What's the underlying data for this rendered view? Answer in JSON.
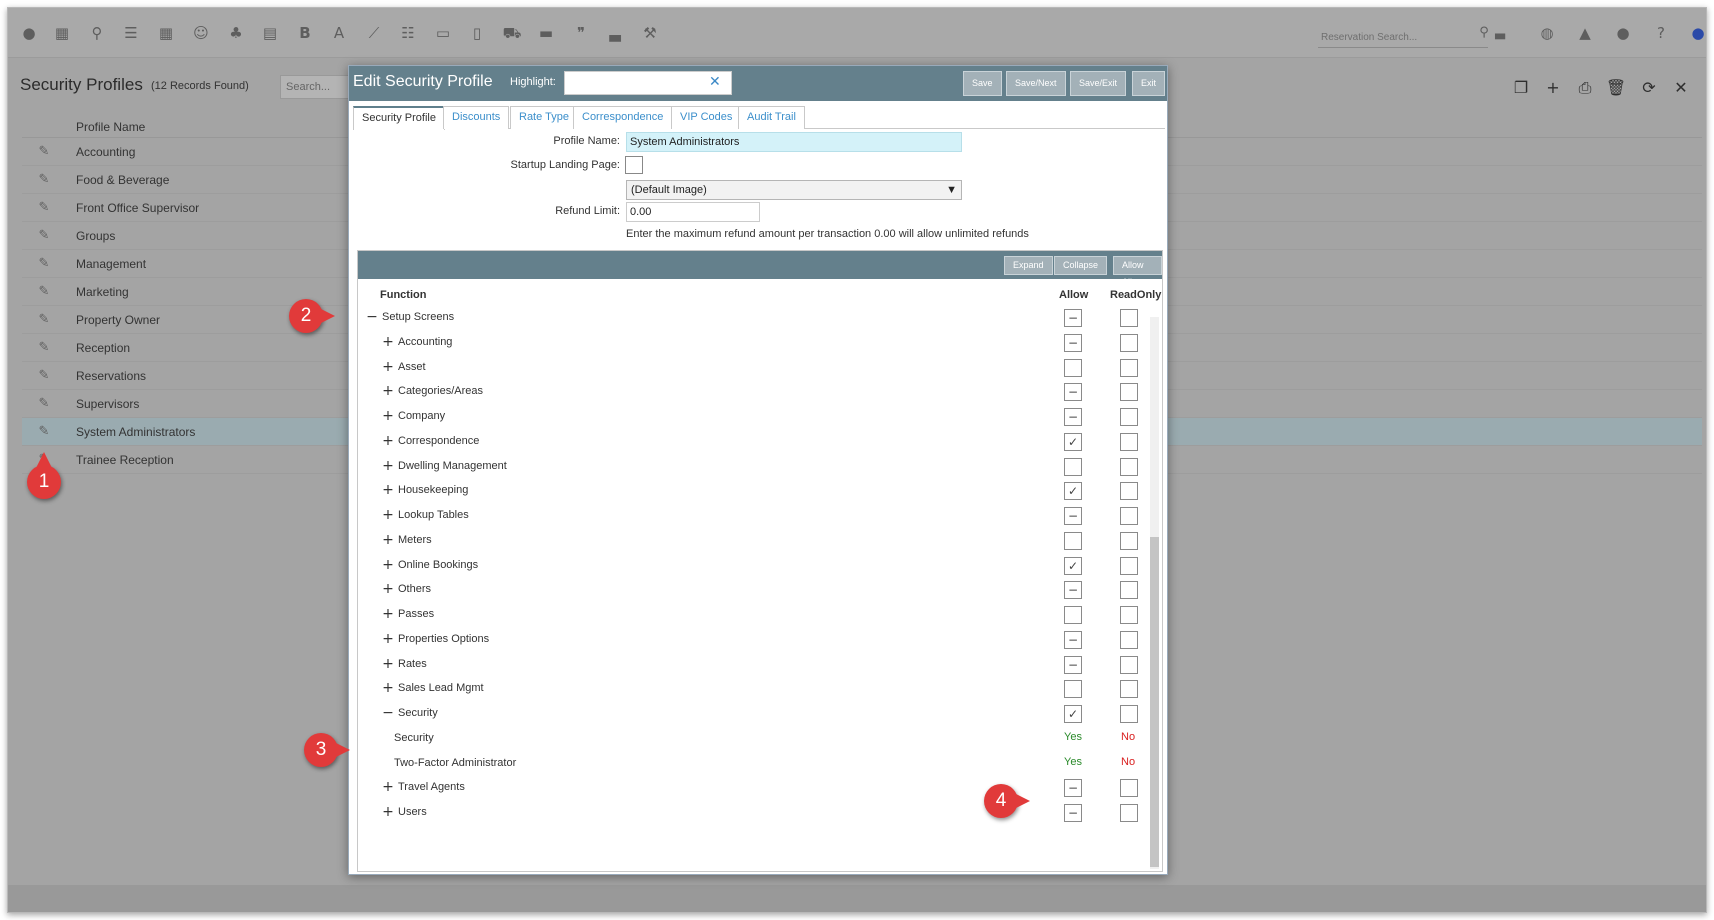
{
  "topbar": {
    "icons": [
      "dashboard-icon",
      "calendar-icon",
      "search-icon",
      "sliders-icon",
      "grid-icon",
      "people-icon",
      "groups-icon",
      "map-icon",
      "bold-icon",
      "font-icon",
      "chart-icon",
      "checklist-icon",
      "card-icon",
      "document-icon",
      "cart-icon",
      "receipt-icon",
      "quote-icon",
      "bed-icon",
      "hammer-icon"
    ],
    "reservation_search_placeholder": "Reservation Search...",
    "right_icons": [
      "globe-icon",
      "bell-icon",
      "chat-icon",
      "help-icon",
      "user-icon"
    ]
  },
  "page": {
    "title": "Security Profiles",
    "record_count": "(12 Records Found)",
    "search_placeholder": "Search...",
    "actions": [
      "copy-icon",
      "add-icon",
      "print-icon",
      "delete-icon",
      "refresh-icon",
      "close-icon"
    ]
  },
  "list": {
    "column_header": "Profile Name",
    "rows": [
      {
        "name": "Accounting",
        "selected": false
      },
      {
        "name": "Food & Beverage",
        "selected": false
      },
      {
        "name": "Front Office Supervisor",
        "selected": false
      },
      {
        "name": "Groups",
        "selected": false
      },
      {
        "name": "Management",
        "selected": false
      },
      {
        "name": "Marketing",
        "selected": false
      },
      {
        "name": "Property Owner",
        "selected": false
      },
      {
        "name": "Reception",
        "selected": false
      },
      {
        "name": "Reservations",
        "selected": false
      },
      {
        "name": "Supervisors",
        "selected": false
      },
      {
        "name": "System Administrators",
        "selected": true
      },
      {
        "name": "Trainee Reception",
        "selected": false
      }
    ]
  },
  "modal": {
    "title": "Edit Security Profile",
    "highlight_label": "Highlight:",
    "highlight_value": "",
    "buttons": {
      "save": "Save",
      "save_next": "Save/Next",
      "save_exit": "Save/Exit",
      "exit": "Exit"
    },
    "tabs": [
      {
        "label": "Security Profile",
        "active": true
      },
      {
        "label": "Discounts",
        "active": false
      },
      {
        "label": "Rate Type",
        "active": false
      },
      {
        "label": "Correspondence",
        "active": false
      },
      {
        "label": "VIP Codes",
        "active": false
      },
      {
        "label": "Audit Trail",
        "active": false
      }
    ],
    "form": {
      "profile_name_label": "Profile Name:",
      "profile_name_value": "System Administrators",
      "landing_label": "Startup Landing Page:",
      "landing_checked": false,
      "image_select": "(Default Image)",
      "refund_label": "Refund Limit:",
      "refund_value": "0.00",
      "refund_note": "Enter the maximum refund amount per transaction 0.00 will allow unlimited refunds"
    },
    "functions": {
      "toolbar": {
        "expand": "Expand",
        "collapse": "Collapse",
        "allow_all": "Allow All"
      },
      "col_function": "Function",
      "col_allow": "Allow",
      "col_readonly": "ReadOnly",
      "rows": [
        {
          "label": "Setup Screens",
          "level": 0,
          "sign": "−",
          "allow": "partial",
          "ro": "none"
        },
        {
          "label": "Accounting",
          "level": 1,
          "sign": "+",
          "allow": "partial",
          "ro": "none"
        },
        {
          "label": "Asset",
          "level": 1,
          "sign": "+",
          "allow": "none",
          "ro": "none"
        },
        {
          "label": "Categories/Areas",
          "level": 1,
          "sign": "+",
          "allow": "partial",
          "ro": "none"
        },
        {
          "label": "Company",
          "level": 1,
          "sign": "+",
          "allow": "partial",
          "ro": "none"
        },
        {
          "label": "Correspondence",
          "level": 1,
          "sign": "+",
          "allow": "check",
          "ro": "none"
        },
        {
          "label": "Dwelling Management",
          "level": 1,
          "sign": "+",
          "allow": "none",
          "ro": "none"
        },
        {
          "label": "Housekeeping",
          "level": 1,
          "sign": "+",
          "allow": "check",
          "ro": "none"
        },
        {
          "label": "Lookup Tables",
          "level": 1,
          "sign": "+",
          "allow": "partial",
          "ro": "none"
        },
        {
          "label": "Meters",
          "level": 1,
          "sign": "+",
          "allow": "none",
          "ro": "none"
        },
        {
          "label": "Online Bookings",
          "level": 1,
          "sign": "+",
          "allow": "check",
          "ro": "none"
        },
        {
          "label": "Others",
          "level": 1,
          "sign": "+",
          "allow": "partial",
          "ro": "none"
        },
        {
          "label": "Passes",
          "level": 1,
          "sign": "+",
          "allow": "none",
          "ro": "none"
        },
        {
          "label": "Properties Options",
          "level": 1,
          "sign": "+",
          "allow": "partial",
          "ro": "none"
        },
        {
          "label": "Rates",
          "level": 1,
          "sign": "+",
          "allow": "partial",
          "ro": "none"
        },
        {
          "label": "Sales Lead Mgmt",
          "level": 1,
          "sign": "+",
          "allow": "none",
          "ro": "none"
        },
        {
          "label": "Security",
          "level": 1,
          "sign": "−",
          "allow": "check",
          "ro": "none"
        },
        {
          "label": "Security",
          "level": 2,
          "allow_text": "Yes",
          "ro_text": "No"
        },
        {
          "label": "Two-Factor Administrator",
          "level": 2,
          "allow_text": "Yes",
          "ro_text": "No"
        },
        {
          "label": "Travel Agents",
          "level": 1,
          "sign": "+",
          "allow": "partial",
          "ro": "none"
        },
        {
          "label": "Users",
          "level": 1,
          "sign": "+",
          "allow": "partial",
          "ro": "none"
        }
      ]
    }
  },
  "callouts": [
    "1",
    "2",
    "3",
    "4"
  ],
  "colors": {
    "header_bar": "#64808c",
    "selected_row": "#9aabb0",
    "callout": "#e13a3a",
    "yes": "#2a8a2a",
    "no": "#d92020",
    "link": "#3c8fcb",
    "profile_name_bg": "#d4f2f9"
  }
}
